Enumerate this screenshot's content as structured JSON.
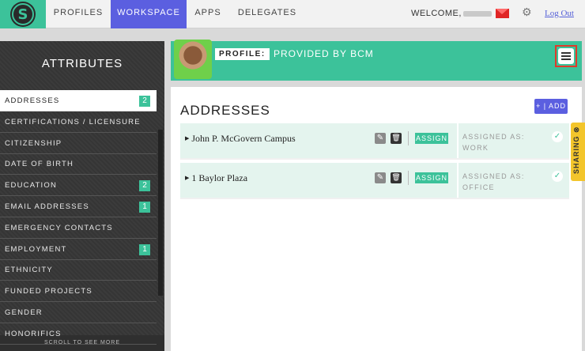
{
  "nav": {
    "tabs": [
      {
        "label": "PROFILES"
      },
      {
        "label": "WORKSPACE"
      },
      {
        "label": "APPS"
      },
      {
        "label": "DELEGATES"
      }
    ],
    "active_tab": "WORKSPACE",
    "welcome": "WELCOME,",
    "logout": "Log Out",
    "logo_letter": "S"
  },
  "sidebar": {
    "title": "ATTRIBUTES",
    "items": [
      {
        "label": "ADDRESSES",
        "badge": "2",
        "active": true
      },
      {
        "label": "CERTIFICATIONS / LICENSURE",
        "badge": ""
      },
      {
        "label": "CITIZENSHIP",
        "badge": ""
      },
      {
        "label": "DATE OF BIRTH",
        "badge": ""
      },
      {
        "label": "EDUCATION",
        "badge": "2"
      },
      {
        "label": "EMAIL ADDRESSES",
        "badge": "1"
      },
      {
        "label": "EMERGENCY CONTACTS",
        "badge": ""
      },
      {
        "label": "EMPLOYMENT",
        "badge": "1"
      },
      {
        "label": "ETHNICITY",
        "badge": ""
      },
      {
        "label": "FUNDED PROJECTS",
        "badge": ""
      },
      {
        "label": "GENDER",
        "badge": ""
      },
      {
        "label": "HONORIFICS",
        "badge": ""
      }
    ],
    "scroll_hint": "SCROLL TO SEE MORE"
  },
  "profile": {
    "label": "PROFILE:",
    "value": "PROVIDED BY BCM"
  },
  "main": {
    "title": "ADDRESSES",
    "add_label": "+ | ADD",
    "rows": [
      {
        "name": "John P. McGovern Campus",
        "assign": "ASSIGN",
        "assigned_label": "ASSIGNED AS:",
        "assigned_value": "WORK"
      },
      {
        "name": "1 Baylor Plaza",
        "assign": "ASSIGN",
        "assigned_label": "ASSIGNED AS:",
        "assigned_value": "OFFICE"
      }
    ]
  },
  "sharing": {
    "label": "SHARING"
  },
  "colors": {
    "accent_green": "#3cc29a",
    "accent_purple": "#5b5fe0",
    "highlight_red": "#e03a2a",
    "sharing_yellow": "#f3c52b"
  }
}
